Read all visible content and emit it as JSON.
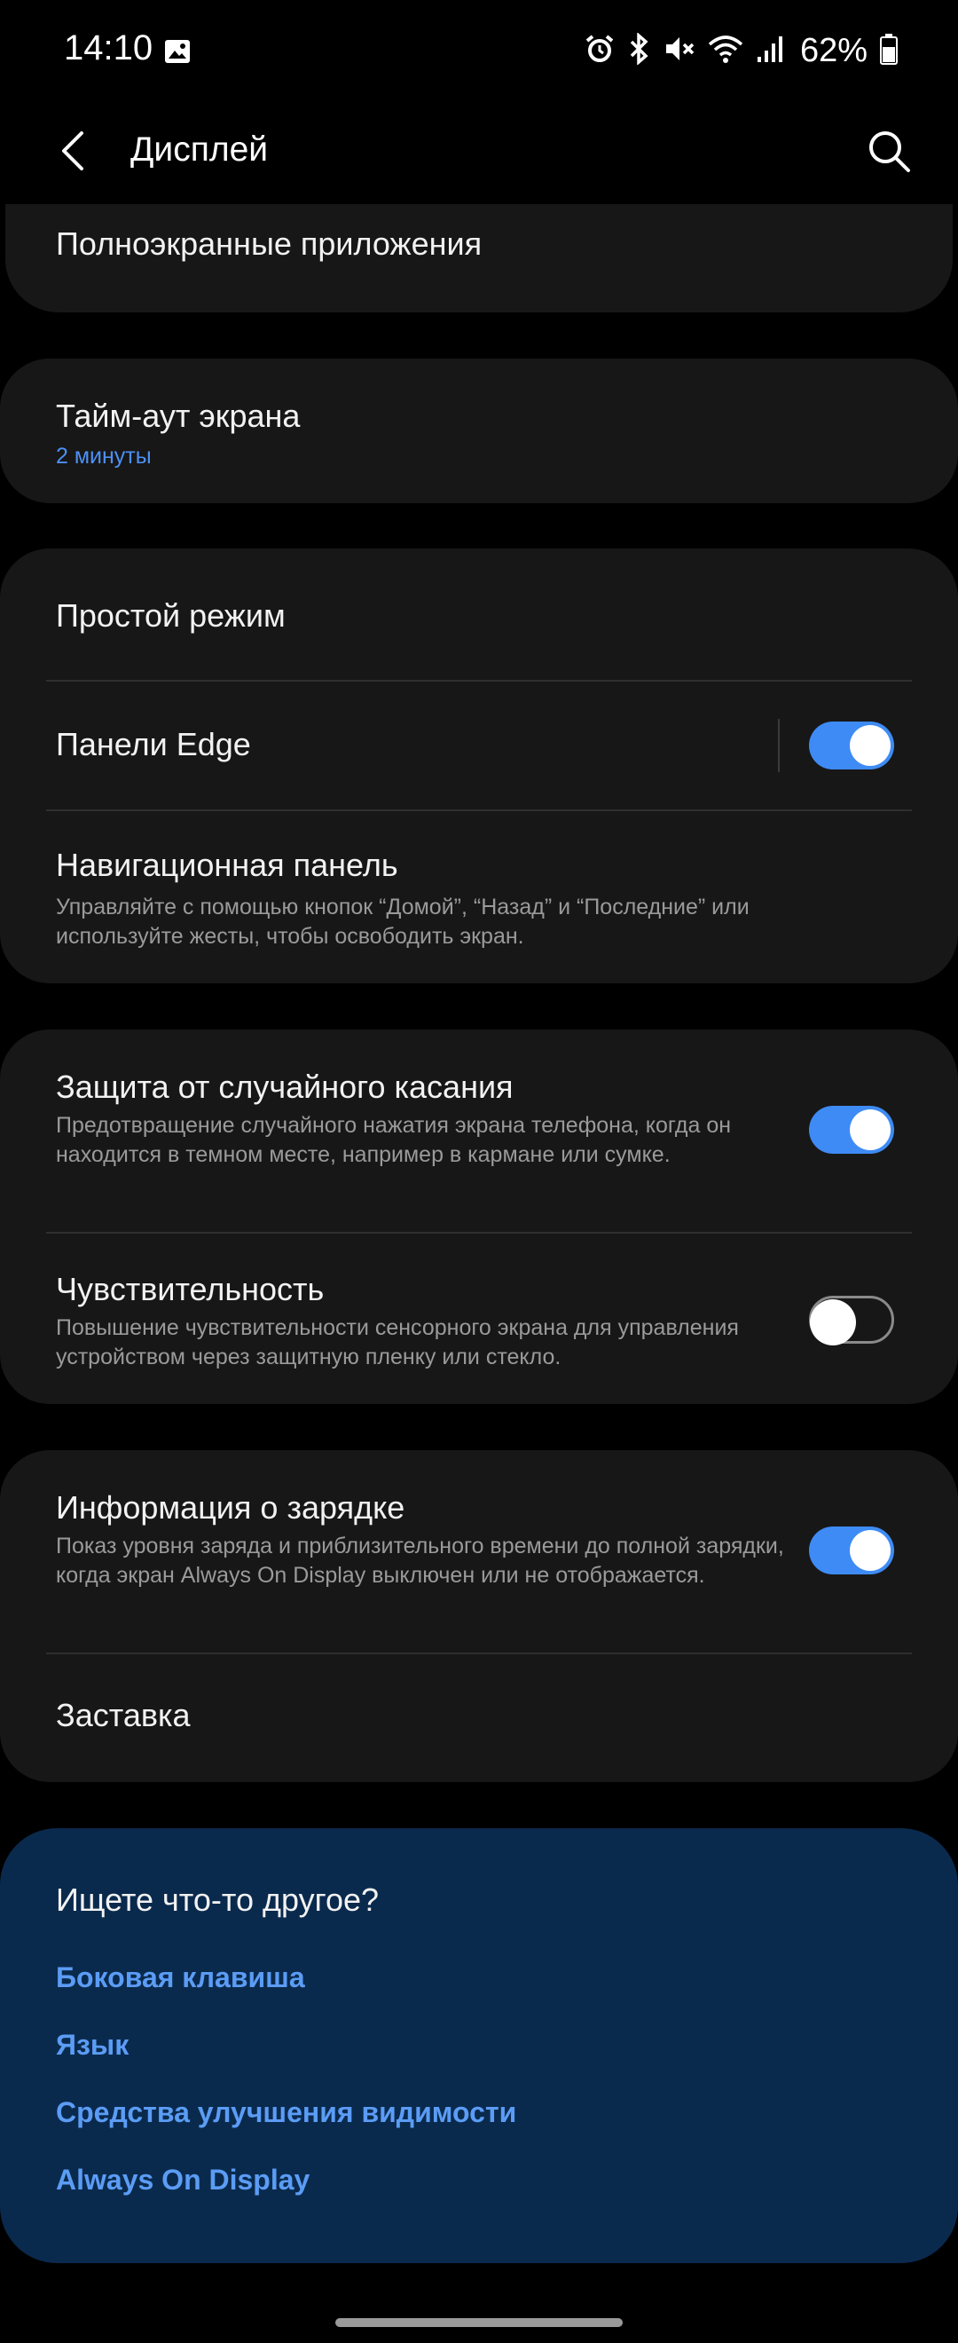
{
  "status_bar": {
    "time": "14:10",
    "battery": "62%",
    "icons": [
      "gallery-icon",
      "alarm-icon",
      "bluetooth-icon",
      "mute-icon",
      "wifi-icon",
      "signal-icon",
      "battery-icon"
    ]
  },
  "header": {
    "title": "Дисплей",
    "back_icon": "back-arrow-icon",
    "search_icon": "search-icon"
  },
  "items": {
    "fullscreen_apps": {
      "title": "Полноэкранные приложения"
    },
    "screen_timeout": {
      "title": "Тайм-аут экрана",
      "value": "2 минуты"
    },
    "easy_mode": {
      "title": "Простой режим"
    },
    "edge_panels": {
      "title": "Панели Edge",
      "enabled": true
    },
    "navigation_bar": {
      "title": "Навигационная панель",
      "description": "Управляйте с помощью кнопок “Домой”, “Назад” и “Последние” или используйте жесты, чтобы освободить экран."
    },
    "accidental_touch": {
      "title": "Защита от случайного касания",
      "description": "Предотвращение случайного нажатия экрана телефона, когда он находится в темном месте, например в кармане или сумке.",
      "enabled": true
    },
    "touch_sensitivity": {
      "title": "Чувствительность",
      "description": "Повышение чувствительности сенсорного экрана для управления устройством через защитную пленку или стекло.",
      "enabled": false
    },
    "charging_info": {
      "title": "Информация о зарядке",
      "description": "Показ уровня заряда и приблизительного времени до полной зарядки, когда экран Always On Display выключен или не отображается.",
      "enabled": true
    },
    "screen_saver": {
      "title": "Заставка"
    }
  },
  "suggestions": {
    "title": "Ищете что-то другое?",
    "links": [
      "Боковая клавиша",
      "Язык",
      "Средства улучшения видимости",
      "Always On Display"
    ]
  },
  "colors": {
    "accent": "#3e8bf5",
    "link": "#5b9cf5",
    "card": "#171717",
    "suggest_card": "#0a2a4d"
  }
}
